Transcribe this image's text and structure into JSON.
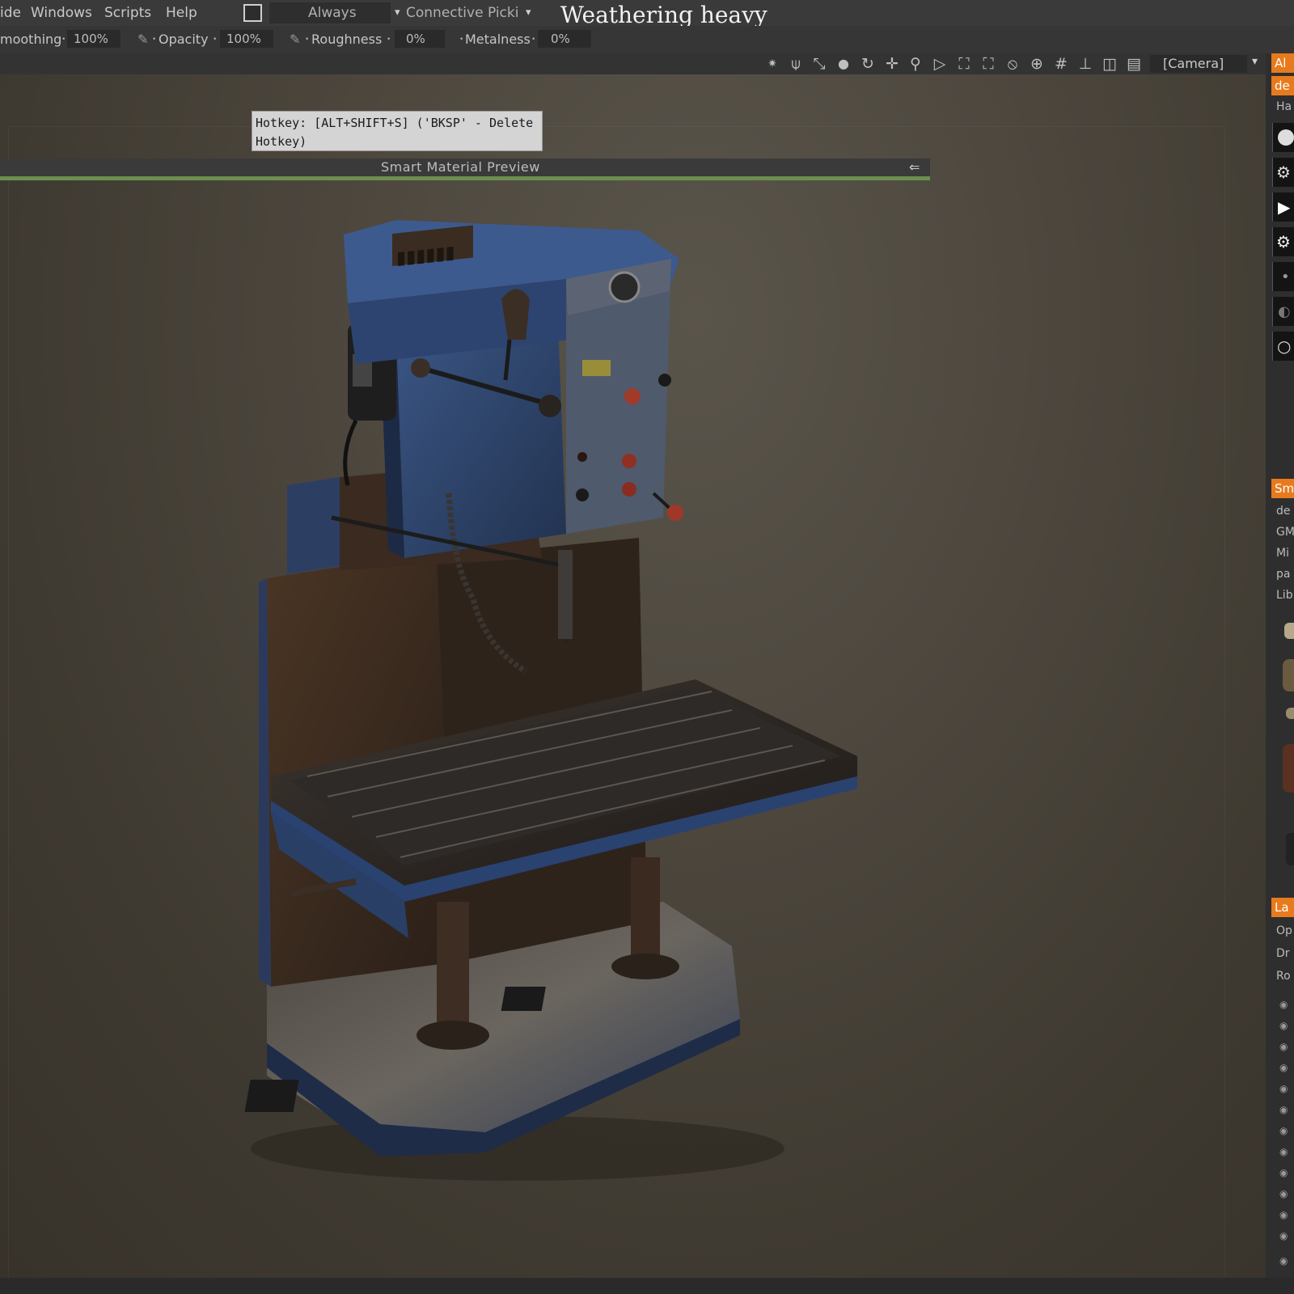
{
  "menu": {
    "items": [
      "ide",
      "Windows",
      "Scripts",
      "Help"
    ],
    "always_label": "Always",
    "picking_label": "Connective Picki",
    "document_title": "Weathering heavy"
  },
  "brush_settings": {
    "smoothing_label": "moothing",
    "smoothing_value": "100%",
    "opacity_label": "Opacity",
    "opacity_value": "100%",
    "roughness_label": "Roughness",
    "roughness_value": "0%",
    "metalness_label": "Metalness",
    "metalness_value": "0%"
  },
  "view_toolbar": {
    "camera_value": "[Camera]",
    "icons": [
      "light-icon",
      "pin-icon",
      "measure-icon",
      "drop-icon",
      "rotate-icon",
      "move-icon",
      "zoom-icon",
      "play-icon",
      "fit-icon",
      "frame-icon",
      "no-icon",
      "globe-icon",
      "grid-icon",
      "axis-icon",
      "split-icon",
      "layout-icon"
    ]
  },
  "tooltip": {
    "line1": "Hotkey: [ALT+SHIFT+S]  ('BKSP' - Delete",
    "line2": "Hotkey)"
  },
  "preview_bar": {
    "label": "Smart Material Preview"
  },
  "right_panel": {
    "tab1": "Al",
    "tab1_sub": "de",
    "tab1_text": "Ha",
    "tab2": "Sm",
    "tab2_items": [
      "de",
      "GM",
      "Mi",
      "pa",
      "Lib"
    ],
    "tab3": "La",
    "tab3_items": [
      "Op",
      "Dr",
      "Ro"
    ]
  },
  "colors": {
    "accent": "#e87a1e",
    "preview_green": "#6b8f4e",
    "machine_blue": "#2f4a7a"
  }
}
